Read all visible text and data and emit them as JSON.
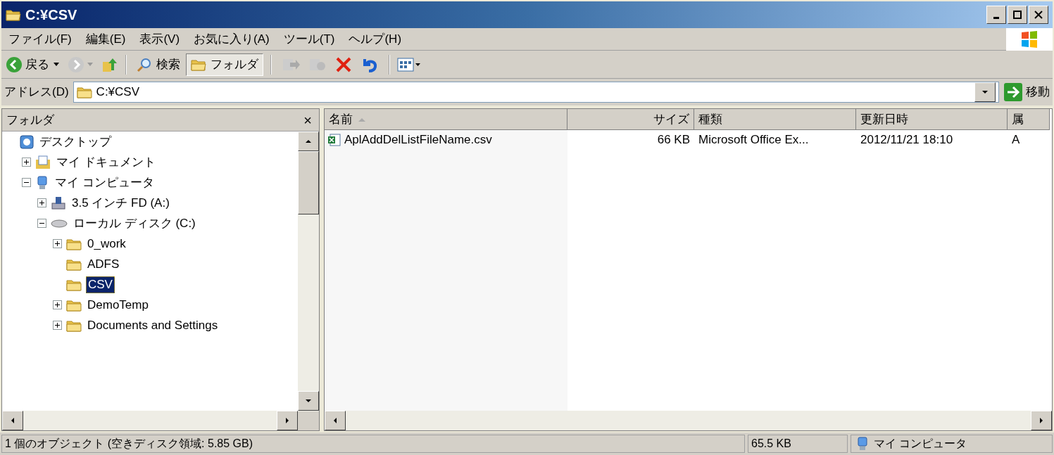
{
  "window": {
    "title": "C:¥CSV"
  },
  "menu": [
    "ファイル(F)",
    "編集(E)",
    "表示(V)",
    "お気に入り(A)",
    "ツール(T)",
    "ヘルプ(H)"
  ],
  "toolbar": {
    "back": "戻る",
    "search": "検索",
    "folders": {
      "label": "フォルダ",
      "selected": true
    }
  },
  "address": {
    "label": "アドレス(D)",
    "value": "C:¥CSV",
    "go": "移動"
  },
  "folder_pane": {
    "title": "フォルダ",
    "close": "×",
    "tree": [
      {
        "label": "デスクトップ",
        "kind": "desktop",
        "selected": false,
        "children": [
          {
            "label": "マイ ドキュメント",
            "kind": "documents",
            "expanded": false,
            "selected": false
          },
          {
            "label": "マイ コンピュータ",
            "kind": "computer",
            "expanded": true,
            "selected": false,
            "children": [
              {
                "label": "3.5 インチ FD (A:)",
                "kind": "floppy",
                "expanded": false,
                "selected": false
              },
              {
                "label": "ローカル ディスク (C:)",
                "kind": "disk",
                "expanded": true,
                "selected": false,
                "children": [
                  {
                    "label": "0_work",
                    "kind": "folder",
                    "expanded": false,
                    "selected": false
                  },
                  {
                    "label": "ADFS",
                    "kind": "folder",
                    "selected": false
                  },
                  {
                    "label": "CSV",
                    "kind": "folder",
                    "selected": true
                  },
                  {
                    "label": "DemoTemp",
                    "kind": "folder",
                    "expanded": false,
                    "selected": false
                  },
                  {
                    "label": "Documents and Settings",
                    "kind": "folder",
                    "expanded": false,
                    "selected": false
                  }
                ]
              }
            ]
          }
        ]
      }
    ]
  },
  "file_list": {
    "columns": [
      {
        "label": "名前",
        "sorted": true
      },
      {
        "label": "サイズ",
        "sorted": false
      },
      {
        "label": "種類",
        "sorted": false
      },
      {
        "label": "更新日時",
        "sorted": false
      },
      {
        "label": "属",
        "sorted": false
      }
    ],
    "rows": [
      {
        "name": "AplAddDelListFileName.csv",
        "size": "66 KB",
        "type": "Microsoft Office Ex...",
        "modified": "2012/11/21 18:10",
        "attributes": "A"
      }
    ]
  },
  "status_bar": {
    "objects": "1 個のオブジェクト (空きディスク領域: 5.85 GB)",
    "size": "65.5 KB",
    "zone": "マイ コンピュータ"
  }
}
